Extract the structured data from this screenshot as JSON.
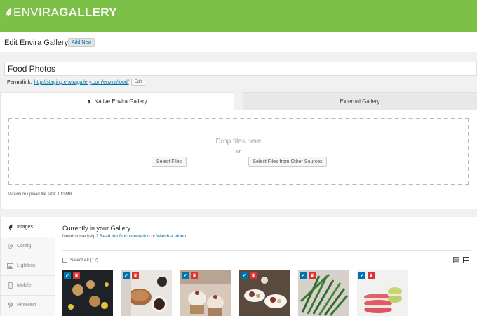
{
  "brand": {
    "logo_light": "ENVIRA",
    "logo_bold": "GALLERY",
    "accent_color": "#7cc048"
  },
  "header": {
    "title": "Edit Envira Gallery",
    "add_new_label": "Add New"
  },
  "post": {
    "title_value": "Food Photos",
    "permalink_label": "Permalink:",
    "permalink_url": "http://staging.enviragallery.com/envira/food/",
    "permalink_edit_label": "Edit"
  },
  "tabs": [
    {
      "label": "Native Envira Gallery",
      "active": true,
      "icon": "leaf-icon"
    },
    {
      "label": "External Gallery",
      "active": false
    }
  ],
  "uploader": {
    "drop_text": "Drop files here",
    "or_text": "or",
    "select_files_label": "Select Files",
    "select_other_label": "Select Files from Other Sources",
    "max_size_text": "Maximum upload file size: 100 MB."
  },
  "sidenav": {
    "items": [
      {
        "label": "Images",
        "icon": "leaf-icon",
        "active": true
      },
      {
        "label": "Config",
        "icon": "gear-icon",
        "active": false
      },
      {
        "label": "Lightbox",
        "icon": "image-icon",
        "active": false
      },
      {
        "label": "Mobile",
        "icon": "mobile-icon",
        "active": false
      },
      {
        "label": "Pinterest",
        "icon": "pinterest-icon",
        "active": false
      }
    ]
  },
  "gallery": {
    "title": "Currently in your Gallery",
    "help_prefix": "Need some help?",
    "doc_link": "Read the Documentation",
    "or_word": "or",
    "video_link": "Watch a Video",
    "select_all_label": "Select All (12)",
    "thumbnails": [
      {
        "subject": "cookies on dark table"
      },
      {
        "subject": "croissant and coffee"
      },
      {
        "subject": "cupcakes with cream"
      },
      {
        "subject": "desserts on plates"
      },
      {
        "subject": "green beans"
      },
      {
        "subject": "macarons"
      }
    ]
  }
}
